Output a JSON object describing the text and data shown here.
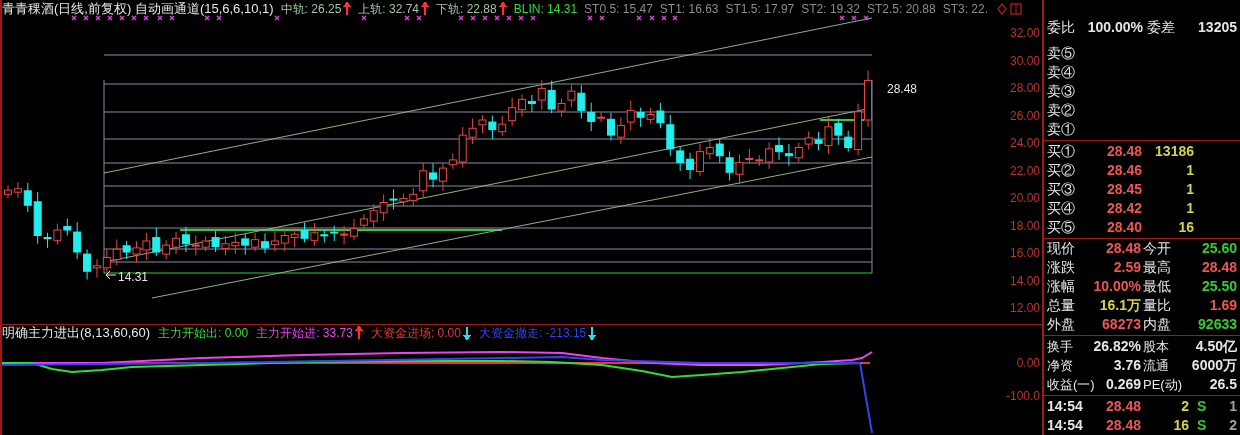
{
  "chart_header": {
    "title": "青青稞酒(日线,前复权) 自动画通道(15,6,6,10,1)",
    "indicators": [
      {
        "label": "中轨: 26.25",
        "color": "#a3c4a3",
        "arrow": {
          "kind": "up",
          "color": "#ff3030"
        }
      },
      {
        "label": "上轨: 32.74",
        "color": "#a3c4a3",
        "arrow": {
          "kind": "up",
          "color": "#ff3030"
        }
      },
      {
        "label": "下轨: 22.88",
        "color": "#a3c4a3",
        "arrow": {
          "kind": "up",
          "color": "#ff3030"
        }
      },
      {
        "label": "BLIN: 14.31",
        "color": "#33dd33"
      },
      {
        "label": "ST0.5: 15.47",
        "color": "#8c8c8c"
      },
      {
        "label": "ST1: 16.63",
        "color": "#8c8c8c"
      },
      {
        "label": "ST1.5: 17.97",
        "color": "#8c8c8c"
      },
      {
        "label": "ST2: 19.32",
        "color": "#8c8c8c"
      },
      {
        "label": "ST2.5: 20.88",
        "color": "#8c8c8c"
      },
      {
        "label": "ST3: 22.",
        "color": "#8c8c8c"
      }
    ]
  },
  "price_labels": {
    "high": "28.48",
    "low": "14.31"
  },
  "price_axis": [
    "32.00",
    "30.00",
    "28.00",
    "26.00",
    "24.00",
    "22.00",
    "20.00",
    "18.00",
    "16.00",
    "14.00",
    "12.00"
  ],
  "indicator_header": {
    "title": "明确主力进出(8,13,60,60)",
    "series": [
      {
        "label": "主力开始出: 0.00",
        "color": "#33dd33"
      },
      {
        "label": "主力开始进: 33.73",
        "color": "#ee44ee",
        "arrow": {
          "kind": "up",
          "color": "#ff3030"
        }
      },
      {
        "label": "大资金进场: 0.00",
        "color": "#ee3333",
        "arrow": {
          "kind": "down",
          "color": "#22ddee"
        }
      },
      {
        "label": "大资金撤走: -213.15",
        "color": "#3344ee",
        "arrow": {
          "kind": "down",
          "color": "#22ddee"
        }
      }
    ]
  },
  "indicator_axis": [
    "0.00",
    "-100.0"
  ],
  "quote_panel": {
    "order_ratio": {
      "label": "委比",
      "value": "100.00%",
      "label2": "委差",
      "value2": "13205"
    },
    "asks": [
      {
        "label": "卖⑤"
      },
      {
        "label": "卖④"
      },
      {
        "label": "卖③"
      },
      {
        "label": "卖②"
      },
      {
        "label": "卖①"
      }
    ],
    "bids": [
      {
        "label": "买①",
        "price": "28.48",
        "volume": "13186"
      },
      {
        "label": "买②",
        "price": "28.46",
        "volume": "1"
      },
      {
        "label": "买③",
        "price": "28.45",
        "volume": "1"
      },
      {
        "label": "买④",
        "price": "28.42",
        "volume": "1"
      },
      {
        "label": "买⑤",
        "price": "28.40",
        "volume": "16"
      }
    ],
    "stats": [
      {
        "label": "现价",
        "value": "28.48",
        "color": "#ee5555"
      },
      {
        "label": "今开",
        "value": "25.60",
        "color": "#33cc33"
      },
      {
        "label": "涨跌",
        "value": "2.59",
        "color": "#ee5555"
      },
      {
        "label": "最高",
        "value": "28.48",
        "color": "#ee5555"
      },
      {
        "label": "涨幅",
        "value": "10.00%",
        "color": "#ee5555"
      },
      {
        "label": "最低",
        "value": "25.50",
        "color": "#33cc33"
      },
      {
        "label": "总量",
        "value": "16.1万",
        "color": "#d4d44a"
      },
      {
        "label": "量比",
        "value": "1.69",
        "color": "#ee5555"
      },
      {
        "label": "外盘",
        "value": "68273",
        "color": "#ee5555"
      },
      {
        "label": "内盘",
        "value": "92633",
        "color": "#33cc33"
      }
    ],
    "fundamentals": [
      {
        "label": "换手",
        "value": "26.82%"
      },
      {
        "label": "股本",
        "value": "4.50亿"
      },
      {
        "label": "净资",
        "value": "3.76"
      },
      {
        "label": "流通",
        "value": "6000万"
      },
      {
        "label": "收益(一)",
        "value": "0.269"
      },
      {
        "label": "PE(动)",
        "value": "26.5"
      }
    ],
    "trades": [
      {
        "time": "14:54",
        "price": "28.48",
        "volume": "2",
        "side": "S",
        "seq": "1"
      },
      {
        "time": "14:54",
        "price": "28.48",
        "volume": "16",
        "side": "S",
        "seq": "2"
      }
    ]
  }
}
